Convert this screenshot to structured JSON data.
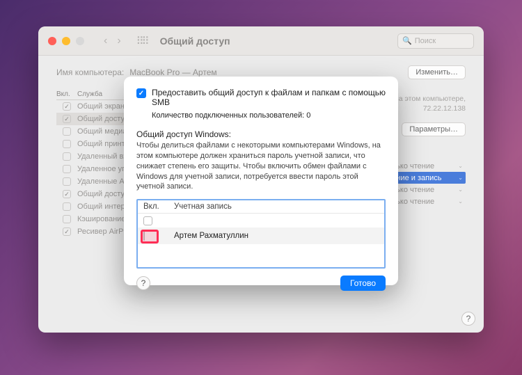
{
  "window": {
    "title": "Общий доступ",
    "search_placeholder": "Поиск"
  },
  "computer_name": {
    "label": "Имя компьютера:",
    "value": "MacBook Pro — Артем",
    "edit_btn": "Изменить…",
    "hint": ""
  },
  "info": {
    "line1": "на этом компьютере,",
    "line2": "72.22.12.138"
  },
  "params_btn": "Параметры…",
  "services": {
    "col_on": "Вкл.",
    "col_service": "Служба",
    "rows": [
      {
        "on": true,
        "label": "Общий экран"
      },
      {
        "on": true,
        "label": "Общий досту"
      },
      {
        "on": false,
        "label": "Общий медиа"
      },
      {
        "on": false,
        "label": "Общий принт"
      },
      {
        "on": false,
        "label": "Удаленный вх"
      },
      {
        "on": false,
        "label": "Удаленное уп"
      },
      {
        "on": false,
        "label": "Удаленные Ap"
      },
      {
        "on": true,
        "label": "Общий досту"
      },
      {
        "on": false,
        "label": "Общий интер"
      },
      {
        "on": false,
        "label": "Кэширование"
      },
      {
        "on": true,
        "label": "Ресивер AirPl"
      }
    ]
  },
  "permissions": [
    {
      "label": "Только чтение",
      "selected": false
    },
    {
      "label": "Чтение и запись",
      "selected": true
    },
    {
      "label": "Только чтение",
      "selected": false
    },
    {
      "label": "Только чтение",
      "selected": false
    }
  ],
  "sheet": {
    "smb_label": "Предоставить общий доступ к файлам и папкам с помощью SMB",
    "connected": "Количество подключенных пользователей: 0",
    "win_title": "Общий доступ Windows:",
    "win_desc": "Чтобы делиться файлами с некоторыми компьютерами Windows, на этом компьютере должен храниться пароль учетной записи, что снижает степень его защиты. Чтобы включить обмен файлами с Windows для учетной записи, потребуется ввести пароль этой учетной записи.",
    "col_on": "Вкл.",
    "col_acct": "Учетная запись",
    "accounts": [
      {
        "on": false,
        "name": "Артем  Рахматуллин"
      }
    ],
    "help": "?",
    "done": "Готово"
  }
}
